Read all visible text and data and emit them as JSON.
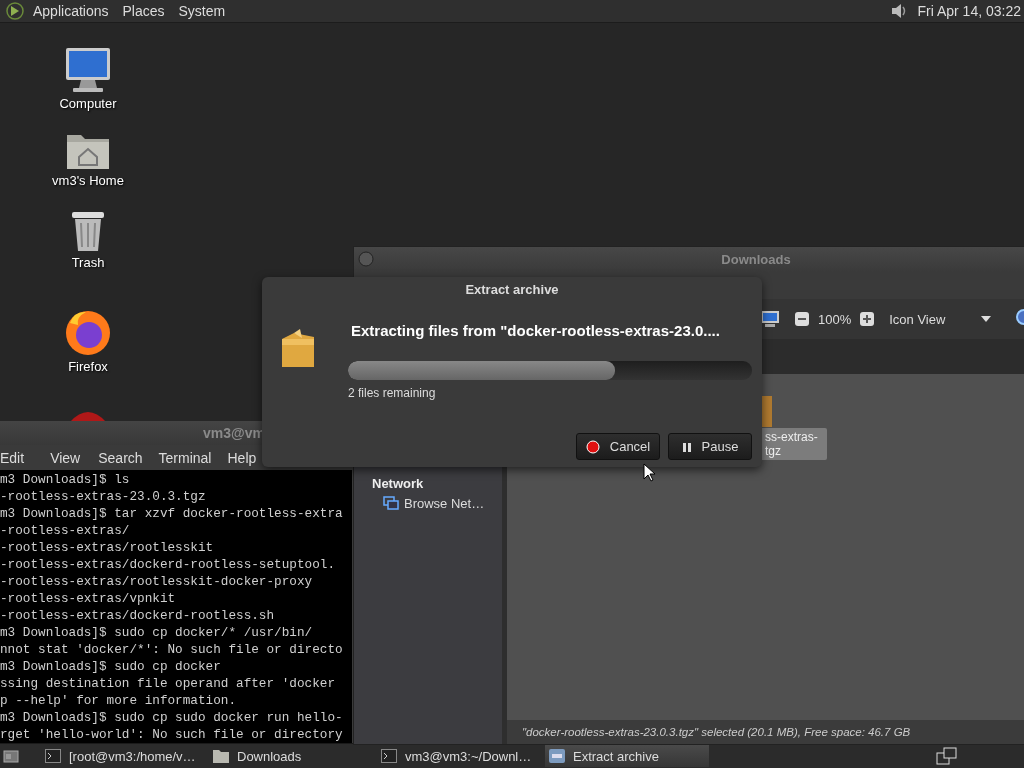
{
  "top_panel": {
    "menus": [
      "Applications",
      "Places",
      "System"
    ],
    "clock": "Fri Apr 14, 03:22"
  },
  "desktop_icons": [
    {
      "label": "Computer",
      "kind": "computer"
    },
    {
      "label": "vm3's Home",
      "kind": "home"
    },
    {
      "label": "Trash",
      "kind": "trash"
    },
    {
      "label": "Firefox",
      "kind": "firefox"
    }
  ],
  "terminal": {
    "title": "vm3@vm",
    "menus": [
      "Edit",
      "View",
      "Search",
      "Terminal",
      "Help"
    ],
    "lines": [
      "m3 Downloads]$ ls",
      "-rootless-extras-23.0.3.tgz",
      "m3 Downloads]$ tar xzvf docker-rootless-extra",
      "-rootless-extras/",
      "-rootless-extras/rootlesskit",
      "-rootless-extras/dockerd-rootless-setuptool.",
      "-rootless-extras/rootlesskit-docker-proxy",
      "-rootless-extras/vpnkit",
      "-rootless-extras/dockerd-rootless.sh",
      "m3 Downloads]$ sudo cp docker/* /usr/bin/",
      "nnot stat 'docker/*': No such file or directo",
      "m3 Downloads]$ sudo cp docker",
      "ssing destination file operand after 'docker",
      "p --help' for more information.",
      "m3 Downloads]$ sudo cp sudo docker run hello-",
      "rget 'hello-world': No such file or directory"
    ]
  },
  "file_manager": {
    "title": "Downloads",
    "zoom": "100%",
    "view": "Icon View",
    "sidebar": [
      {
        "heading": "Network",
        "items": [
          {
            "label": "Browse Net…"
          }
        ]
      }
    ],
    "files": [
      {
        "label_lines": [
          "ss-extras-",
          "tgz"
        ],
        "selected": true
      }
    ],
    "status": "\"docker-rootless-extras-23.0.3.tgz\" selected (20.1 MB), Free space: 46.7 GB"
  },
  "dialog": {
    "title": "Extract archive",
    "heading": "Extracting files from \"docker-rootless-extras-23.0....",
    "progress": {
      "level": 0.66
    },
    "status": "2 files remaining",
    "buttons": [
      {
        "label": "Cancel",
        "kind": "cancel"
      },
      {
        "label": "Pause",
        "kind": "pause"
      }
    ]
  },
  "taskbar": {
    "tasks": [
      {
        "label": "[root@vm3:/home/v…",
        "kind": "terminal",
        "selected": false
      },
      {
        "label": "Downloads",
        "kind": "folder",
        "selected": false
      },
      {
        "label": "vm3@vm3:~/Downl…",
        "kind": "terminal",
        "selected": false
      },
      {
        "label": "Extract archive",
        "kind": "archive",
        "selected": true
      }
    ]
  }
}
